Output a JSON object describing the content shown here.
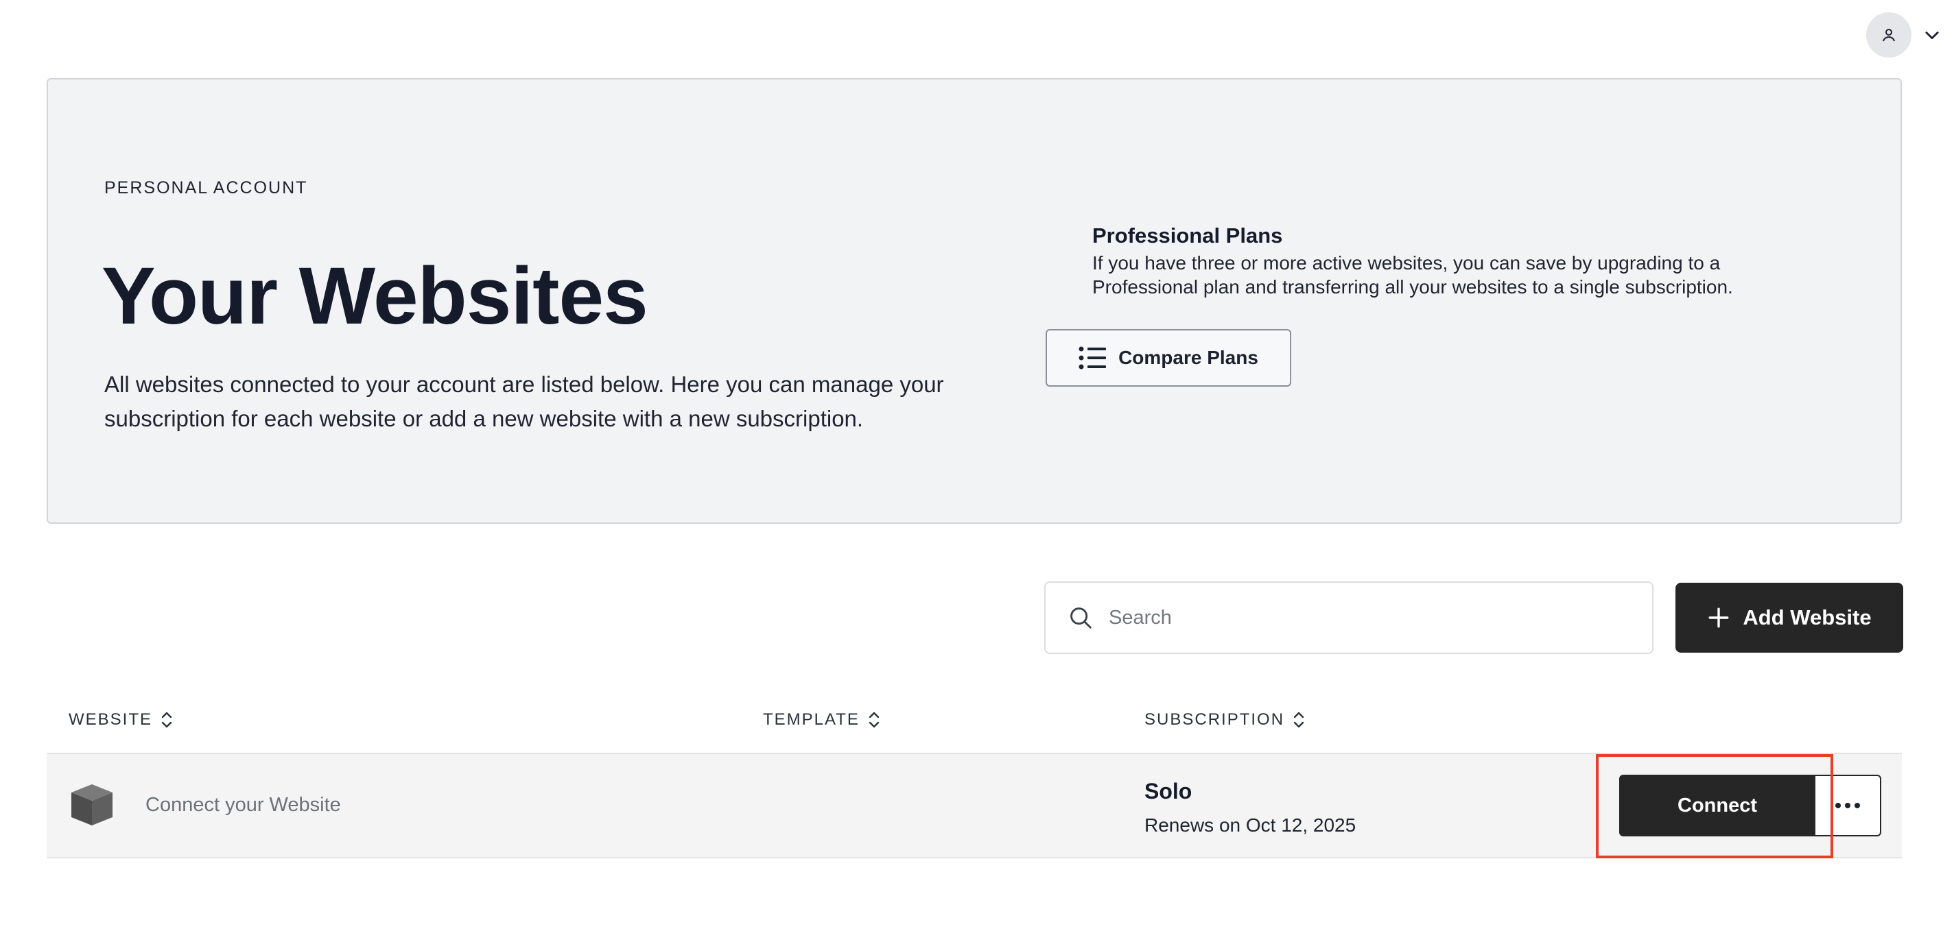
{
  "account": {
    "avatar_icon": "user-icon",
    "menu_icon": "chevron-down-icon"
  },
  "hero": {
    "eyebrow": "PERSONAL ACCOUNT",
    "title": "Your Websites",
    "description": "All websites connected to your account are listed below. Here you can manage your subscription for each website or add a new website with a new subscription."
  },
  "plans": {
    "title": "Professional Plans",
    "description": "If you have three or more active websites, you can save by upgrading to a Professional plan and transferring all your websites to a single subscription.",
    "compare_label": "Compare Plans",
    "compare_icon": "list-icon"
  },
  "search": {
    "placeholder": "Search",
    "value": "",
    "icon": "search-icon"
  },
  "add_website": {
    "label": "Add Website",
    "icon": "plus-icon"
  },
  "table": {
    "columns": [
      "WEBSITE",
      "TEMPLATE",
      "SUBSCRIPTION"
    ],
    "sort_icon": "sort-icon",
    "rows": [
      {
        "website": "Connect your Website",
        "template": "",
        "plan": "Solo",
        "renewal": "Renews on Oct 12, 2025",
        "action_label": "Connect",
        "site_icon": "cube-icon",
        "more_icon": "more-horizontal-icon"
      }
    ]
  },
  "colors": {
    "primary_button": "#262626",
    "hero_background": "#f2f3f5",
    "highlight": "#e4402c"
  }
}
